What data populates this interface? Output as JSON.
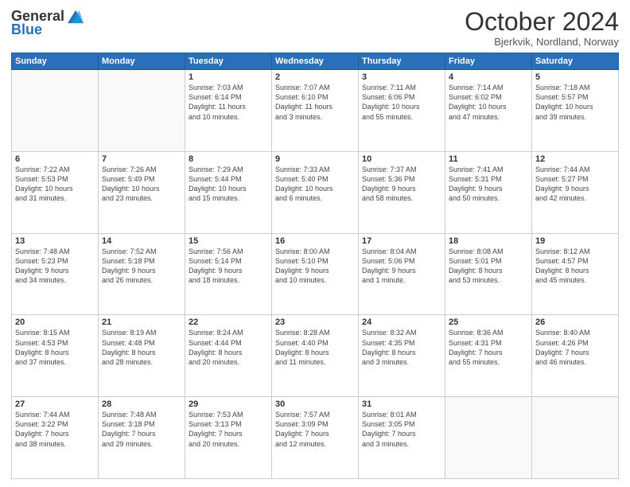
{
  "logo": {
    "general": "General",
    "blue": "Blue"
  },
  "header": {
    "month": "October 2024",
    "location": "Bjerkvik, Nordland, Norway"
  },
  "days_of_week": [
    "Sunday",
    "Monday",
    "Tuesday",
    "Wednesday",
    "Thursday",
    "Friday",
    "Saturday"
  ],
  "weeks": [
    [
      {
        "day": "",
        "detail": ""
      },
      {
        "day": "",
        "detail": ""
      },
      {
        "day": "1",
        "detail": "Sunrise: 7:03 AM\nSunset: 6:14 PM\nDaylight: 11 hours\nand 10 minutes."
      },
      {
        "day": "2",
        "detail": "Sunrise: 7:07 AM\nSunset: 6:10 PM\nDaylight: 11 hours\nand 3 minutes."
      },
      {
        "day": "3",
        "detail": "Sunrise: 7:11 AM\nSunset: 6:06 PM\nDaylight: 10 hours\nand 55 minutes."
      },
      {
        "day": "4",
        "detail": "Sunrise: 7:14 AM\nSunset: 6:02 PM\nDaylight: 10 hours\nand 47 minutes."
      },
      {
        "day": "5",
        "detail": "Sunrise: 7:18 AM\nSunset: 5:57 PM\nDaylight: 10 hours\nand 39 minutes."
      }
    ],
    [
      {
        "day": "6",
        "detail": "Sunrise: 7:22 AM\nSunset: 5:53 PM\nDaylight: 10 hours\nand 31 minutes."
      },
      {
        "day": "7",
        "detail": "Sunrise: 7:26 AM\nSunset: 5:49 PM\nDaylight: 10 hours\nand 23 minutes."
      },
      {
        "day": "8",
        "detail": "Sunrise: 7:29 AM\nSunset: 5:44 PM\nDaylight: 10 hours\nand 15 minutes."
      },
      {
        "day": "9",
        "detail": "Sunrise: 7:33 AM\nSunset: 5:40 PM\nDaylight: 10 hours\nand 6 minutes."
      },
      {
        "day": "10",
        "detail": "Sunrise: 7:37 AM\nSunset: 5:36 PM\nDaylight: 9 hours\nand 58 minutes."
      },
      {
        "day": "11",
        "detail": "Sunrise: 7:41 AM\nSunset: 5:31 PM\nDaylight: 9 hours\nand 50 minutes."
      },
      {
        "day": "12",
        "detail": "Sunrise: 7:44 AM\nSunset: 5:27 PM\nDaylight: 9 hours\nand 42 minutes."
      }
    ],
    [
      {
        "day": "13",
        "detail": "Sunrise: 7:48 AM\nSunset: 5:23 PM\nDaylight: 9 hours\nand 34 minutes."
      },
      {
        "day": "14",
        "detail": "Sunrise: 7:52 AM\nSunset: 5:18 PM\nDaylight: 9 hours\nand 26 minutes."
      },
      {
        "day": "15",
        "detail": "Sunrise: 7:56 AM\nSunset: 5:14 PM\nDaylight: 9 hours\nand 18 minutes."
      },
      {
        "day": "16",
        "detail": "Sunrise: 8:00 AM\nSunset: 5:10 PM\nDaylight: 9 hours\nand 10 minutes."
      },
      {
        "day": "17",
        "detail": "Sunrise: 8:04 AM\nSunset: 5:06 PM\nDaylight: 9 hours\nand 1 minute."
      },
      {
        "day": "18",
        "detail": "Sunrise: 8:08 AM\nSunset: 5:01 PM\nDaylight: 8 hours\nand 53 minutes."
      },
      {
        "day": "19",
        "detail": "Sunrise: 8:12 AM\nSunset: 4:57 PM\nDaylight: 8 hours\nand 45 minutes."
      }
    ],
    [
      {
        "day": "20",
        "detail": "Sunrise: 8:15 AM\nSunset: 4:53 PM\nDaylight: 8 hours\nand 37 minutes."
      },
      {
        "day": "21",
        "detail": "Sunrise: 8:19 AM\nSunset: 4:48 PM\nDaylight: 8 hours\nand 28 minutes."
      },
      {
        "day": "22",
        "detail": "Sunrise: 8:24 AM\nSunset: 4:44 PM\nDaylight: 8 hours\nand 20 minutes."
      },
      {
        "day": "23",
        "detail": "Sunrise: 8:28 AM\nSunset: 4:40 PM\nDaylight: 8 hours\nand 11 minutes."
      },
      {
        "day": "24",
        "detail": "Sunrise: 8:32 AM\nSunset: 4:35 PM\nDaylight: 8 hours\nand 3 minutes."
      },
      {
        "day": "25",
        "detail": "Sunrise: 8:36 AM\nSunset: 4:31 PM\nDaylight: 7 hours\nand 55 minutes."
      },
      {
        "day": "26",
        "detail": "Sunrise: 8:40 AM\nSunset: 4:26 PM\nDaylight: 7 hours\nand 46 minutes."
      }
    ],
    [
      {
        "day": "27",
        "detail": "Sunrise: 7:44 AM\nSunset: 3:22 PM\nDaylight: 7 hours\nand 38 minutes."
      },
      {
        "day": "28",
        "detail": "Sunrise: 7:48 AM\nSunset: 3:18 PM\nDaylight: 7 hours\nand 29 minutes."
      },
      {
        "day": "29",
        "detail": "Sunrise: 7:53 AM\nSunset: 3:13 PM\nDaylight: 7 hours\nand 20 minutes."
      },
      {
        "day": "30",
        "detail": "Sunrise: 7:57 AM\nSunset: 3:09 PM\nDaylight: 7 hours\nand 12 minutes."
      },
      {
        "day": "31",
        "detail": "Sunrise: 8:01 AM\nSunset: 3:05 PM\nDaylight: 7 hours\nand 3 minutes."
      },
      {
        "day": "",
        "detail": ""
      },
      {
        "day": "",
        "detail": ""
      }
    ]
  ]
}
